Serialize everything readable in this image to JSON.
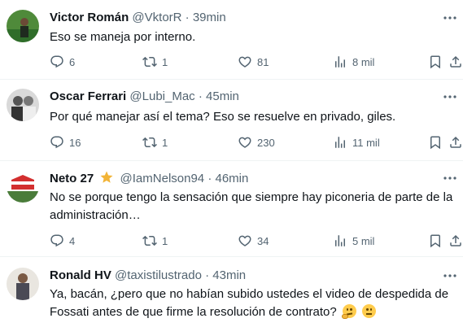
{
  "tweets": [
    {
      "name": "Victor Román",
      "handle": "@VktorR",
      "sep": "·",
      "time": "39min",
      "text": "Eso se maneja por interno.",
      "replies": "6",
      "retweets": "1",
      "likes": "81",
      "views": "8 mil"
    },
    {
      "name": "Oscar Ferrari",
      "handle": "@Lubi_Mac",
      "sep": "·",
      "time": "45min",
      "text": "Por qué manejar así el tema? Eso se resuelve en privado, giles.",
      "replies": "16",
      "retweets": "1",
      "likes": "230",
      "views": "11 mil"
    },
    {
      "name": "Neto 27",
      "handle": "@IamNelson94",
      "sep": "·",
      "time": "46min",
      "text_line1": "No se porque tengo la sensación que siempre hay piconeria de parte de la",
      "text_line2": "administración…",
      "replies": "4",
      "retweets": "1",
      "likes": "34",
      "views": "5 mil"
    },
    {
      "name": "Ronald HV",
      "handle": "@taxistilustrado",
      "sep": "·",
      "time": "43min",
      "text_line1": "Ya, bacán, ¿pero que no habían subido ustedes el video de despedida de",
      "text_line2": "Fossati antes de que firme la resolución de contrato?"
    }
  ],
  "icons": {
    "reply": "reply-icon",
    "retweet": "retweet-icon",
    "like": "heart-icon",
    "views": "views-icon",
    "bookmark": "bookmark-icon",
    "share": "share-icon",
    "more": "more-icon",
    "star": "star-icon"
  },
  "colors": {
    "text": "#0f1419",
    "muted": "#536471",
    "divider": "#eff3f4",
    "star": "#f2b437"
  }
}
